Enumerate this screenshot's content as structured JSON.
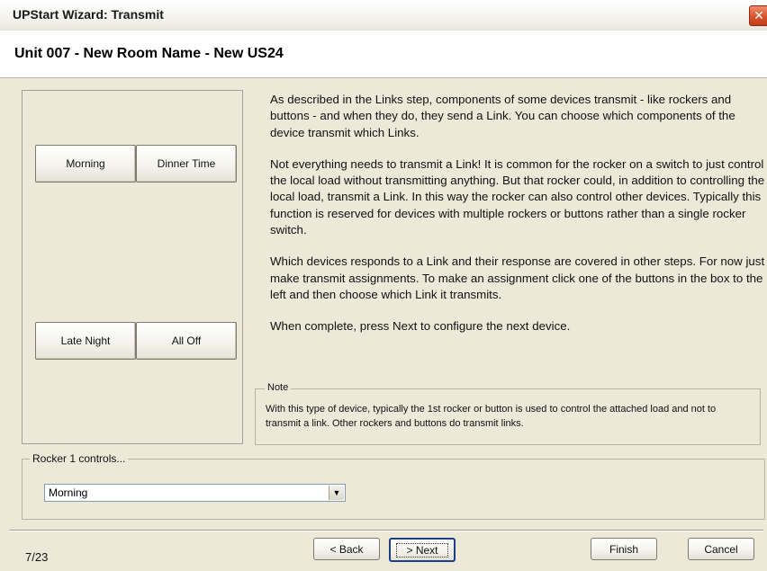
{
  "window": {
    "title": "UPStart Wizard: Transmit",
    "close_glyph": "✕"
  },
  "header": {
    "subtitle": "Unit 007 - New Room Name - New US24"
  },
  "device_buttons": [
    {
      "label": "Morning"
    },
    {
      "label": "Dinner Time"
    },
    {
      "label": "Late Night"
    },
    {
      "label": "All Off"
    }
  ],
  "description": {
    "paragraphs": [
      "As described in the Links step, components of some devices transmit - like rockers and buttons - and when they do, they send a Link. You can choose which components of the device transmit which Links.",
      "Not everything needs to transmit a Link! It is common for the rocker on a switch to just control the local load without transmitting anything. But that rocker could, in addition to controlling the local load, transmit a Link. In this way the rocker can also control other devices. Typically this function is reserved for devices with multiple rockers or buttons rather than a single rocker switch.",
      "Which devices responds to a Link and their response are covered in other steps. For now just make transmit assignments. To make an assignment click one of the buttons in the box to the left and then choose which Link it transmits.",
      "When complete, press Next to configure the next device."
    ]
  },
  "note": {
    "legend": "Note",
    "text": "With this type of device, typically the 1st rocker or button is used to control the attached load and not to transmit a link.  Other rockers and buttons do transmit links."
  },
  "rocker": {
    "legend": "Rocker 1 controls...",
    "selected": "Morning",
    "arrow_glyph": "▼"
  },
  "footer": {
    "step": "7/23",
    "back_label": "< Back",
    "next_label": "> Next",
    "finish_label": "Finish",
    "cancel_label": "Cancel"
  }
}
